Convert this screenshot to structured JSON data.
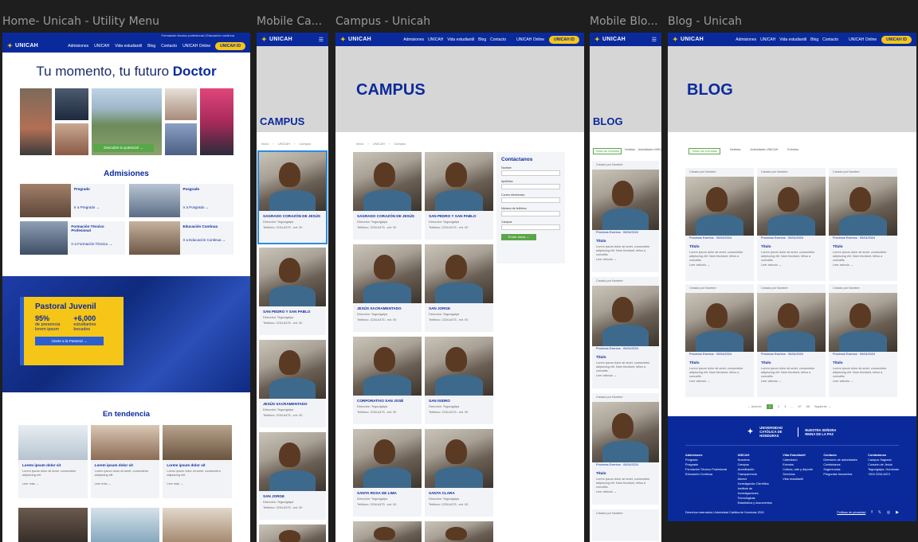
{
  "frames": {
    "home": "Home- Unicah - Utility Menu",
    "mobile_campus": "Mobile Ca...",
    "campus": "Campus - Unicah",
    "mobile_blog": "Mobile Blo...",
    "blog": "Blog - Unicah"
  },
  "brand": {
    "logo": "UNICAH",
    "star": "✦"
  },
  "nav": {
    "links": [
      "Admisiones",
      "UNICAH",
      "Vida estudiantil",
      "Blog",
      "Contacto"
    ],
    "online": "UNICAH Online",
    "id_button": "UNICAH ID"
  },
  "home": {
    "hero_title": "Tu momento, tu futuro",
    "hero_bold": "Doctor",
    "hero_cta": "Descubre tu potencial →",
    "admisiones_title": "Admisiones",
    "programs": [
      {
        "title": "Pregrado",
        "link": "Ir a Pregrado →"
      },
      {
        "title": "Posgrado",
        "link": "Ir a Posgrado →"
      },
      {
        "title": "Formación Técnico Profesional",
        "link": "Ir a Formación Técnico →"
      },
      {
        "title": "Educación Continua",
        "link": "Ir a Educación Continua →"
      }
    ],
    "pastoral_title": "Pastoral Juvenil",
    "stat1_num": "95%",
    "stat1_label": "de presencia lorem ipsum",
    "stat2_num": "+6,000",
    "stat2_label": "estudiantes becados",
    "pastoral_btn": "Únete a la Pastoral →",
    "tendencia_title": "En tendencia",
    "trend_card_title": "Lorem ipsum dolor sit",
    "trend_card_link": "Leer más →"
  },
  "campus": {
    "title": "CAMPUS",
    "breadcrumb": [
      "Inicio",
      "UNICAH",
      "Campus"
    ],
    "contact_title": "Contáctanos",
    "contact_fields": [
      "Nombre",
      "Apellidos",
      "Correo electrónico",
      "Número de teléfono",
      "Campus"
    ],
    "contact_btn": "Enviar ahora →",
    "sites": [
      "SAGRADO CORAZÓN DE JESÚS",
      "SAN PEDRO Y SAN PABLO",
      "JESÚS SACRAMENTADO",
      "SAN JORGE",
      "CORPORATIVO SAN JOSÉ",
      "SAN ISIDRO",
      "SANTA ROSA DE LIMA",
      "SANTA CLARA"
    ],
    "site_dir": "Dirección: Tegucigalpa",
    "site_tel": "Teléfono: 2234-6475 - ext. 00"
  },
  "blog": {
    "title": "BLOG",
    "tabs": [
      "Todas las entradas",
      "Noticias",
      "Actividades UNICAH",
      "Eventos"
    ],
    "author": "Creado por Nombre",
    "tag": "Próximos Eventos",
    "date": "00/04/2024",
    "post_title": "Título",
    "post_text": "Lorem ipsum dolor sit amet, consectetur adipiscing elit. Nam tincidunt, tellus a convallis.",
    "read_more": "Leer artículo →",
    "pagination": [
      "← Anterior",
      "1",
      "2",
      "3",
      "...",
      "67",
      "68",
      "Siguiente →"
    ],
    "footer_brand": "UNIVERSIDAD CATÓLICA DE HONDURAS",
    "footer_tag": "NUESTRA SEÑORA REINA DE LA PAZ",
    "footer_cols": [
      {
        "h": "Admisiones",
        "items": [
          "Pregrado",
          "Posgrado",
          "Formación Técnico Profesional",
          "Educación Continua"
        ]
      },
      {
        "h": "UNICAH",
        "items": [
          "Nosotros",
          "Campus",
          "Acreditación",
          "Transparencia",
          "Alumni",
          "Investigación Científica",
          "Instituto de Investigaciones Tecnológicas",
          "Estadística y documentos"
        ]
      },
      {
        "h": "Vida Estudiantil",
        "items": [
          "Calendario",
          "Eventos",
          "Cultura, arte y deporte",
          "Servicios",
          "Vida estudiantil"
        ]
      },
      {
        "h": "Contacto",
        "items": [
          "Directorio de autoridades",
          "Contáctanos",
          "Sugerencias",
          "Preguntas frecuentes"
        ]
      },
      {
        "h": "Contáctanos",
        "items": [
          "Campus Sagrado",
          "Corazón de Jesús",
          "Tegucigalpa, Honduras",
          "+504 2234-6474"
        ]
      }
    ],
    "copyright": "Derechos reservados Universidad Católica de Honduras 2024",
    "policy": "Políticas de privacidad"
  },
  "colors": {
    "brand_blue": "#0a2a9c",
    "accent_yellow": "#f5c518",
    "hero_grey": "#d6d6d6"
  }
}
